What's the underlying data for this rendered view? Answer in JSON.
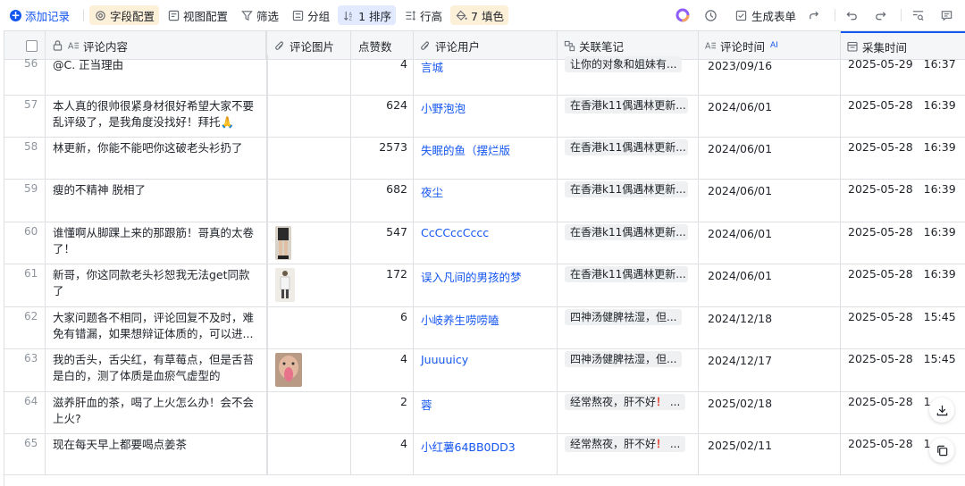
{
  "toolbar": {
    "add_record": "添加记录",
    "field_config": "字段配置",
    "view_config": "视图配置",
    "filter": "筛选",
    "group": "分组",
    "sort": "1 排序",
    "row_height": "行高",
    "fill_color": "7 填色",
    "generate_form": "生成表单"
  },
  "columns": {
    "comment": "评论内容",
    "image": "评论图片",
    "likes": "点赞数",
    "user": "评论用户",
    "note": "关联笔记",
    "comment_time": "评论时间",
    "ai_tag": "AI",
    "collect_time": "采集时间"
  },
  "rows": [
    {
      "num": "56",
      "comment": "@C. 正当理由",
      "likes": "4",
      "user": "言城",
      "note": "让你的对象和姐妹有...",
      "note_warn": "",
      "ctime": "2023/09/16",
      "date": "2025-05-29",
      "time": "16:37",
      "img": ""
    },
    {
      "num": "57",
      "comment": "本人真的很帅很紧身材很好希望大家不要乱评级了，是我角度没找好！拜托🙏",
      "likes": "624",
      "user": "小野泡泡",
      "note": "在香港k11偶遇林更新...",
      "note_warn": "",
      "ctime": "2024/06/01",
      "date": "2025-05-28",
      "time": "16:39",
      "img": ""
    },
    {
      "num": "58",
      "comment": "林更新，你能不能吧你这破老头衫扔了",
      "likes": "2573",
      "user": "失眠的鱼（摆烂版",
      "note": "在香港k11偶遇林更新...",
      "note_warn": "",
      "ctime": "2024/06/01",
      "date": "2025-05-28",
      "time": "16:39",
      "img": ""
    },
    {
      "num": "59",
      "comment": "瘦的不精神 脱相了",
      "likes": "682",
      "user": "夜尘",
      "note": "在香港k11偶遇林更新...",
      "note_warn": "",
      "ctime": "2024/06/01",
      "date": "2025-05-28",
      "time": "16:39",
      "img": ""
    },
    {
      "num": "60",
      "comment": "谁懂啊从脚踝上来的那跟筋！哥真的太卷了！",
      "likes": "547",
      "user": "CcCCccCccc",
      "note": "在香港k11偶遇林更新...",
      "note_warn": "",
      "ctime": "2024/06/01",
      "date": "2025-05-28",
      "time": "16:39",
      "img": "legs"
    },
    {
      "num": "61",
      "comment": "新哥，你这同款老头衫恕我无法get同款了",
      "likes": "172",
      "user": "误入凡间的男孩的梦",
      "note": "在香港k11偶遇林更新...",
      "note_warn": "",
      "ctime": "2024/06/01",
      "date": "2025-05-28",
      "time": "16:39",
      "img": "person"
    },
    {
      "num": "62",
      "comment": "大家问题各不相同，评论回复不及时，难免有错漏，如果想辩证体质的，可以进...",
      "likes": "6",
      "user": "小岐养生唠唠嗑",
      "note": "四神汤健脾祛湿，但...",
      "note_warn": "",
      "ctime": "2024/12/18",
      "date": "2025-05-28",
      "time": "15:45",
      "img": ""
    },
    {
      "num": "63",
      "comment": "我的舌头，舌尖红，有草莓点，但是舌苔是白的，测了体质是血瘀气虚型的",
      "likes": "4",
      "user": "Juuuuicy",
      "note": "四神汤健脾祛湿，但...",
      "note_warn": "",
      "ctime": "2024/12/17",
      "date": "2025-05-28",
      "time": "15:45",
      "img": "face"
    },
    {
      "num": "64",
      "comment": "滋养肝血的茶，喝了上火怎么办！会不会上火?",
      "likes": "2",
      "user": "蓉",
      "note": "经常熬夜，肝不好",
      "note_warn": "！...",
      "ctime": "2025/02/18",
      "date": "2025-05-28",
      "time": "1",
      "img": ""
    },
    {
      "num": "65",
      "comment": "现在每天早上都要喝点姜茶",
      "likes": "4",
      "user": "小红薯64BB0DD3",
      "note": "经常熬夜，肝不好",
      "note_warn": "！...",
      "ctime": "2025/02/11",
      "date": "2025-05-28",
      "time": "1",
      "img": ""
    }
  ],
  "colors": {
    "accent": "#1456f0",
    "header_bg": "#f5f6f7",
    "border": "#dee0e3"
  }
}
